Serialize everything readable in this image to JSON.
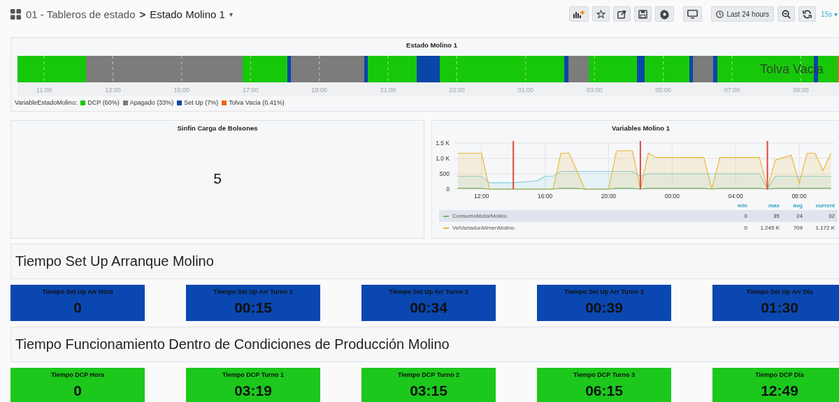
{
  "topbar": {
    "folder": "01 - Tableros de estado",
    "separator": ">",
    "dashboard": "Estado Molino 1",
    "caret": "▾",
    "time_range": "Last 24 hours",
    "refresh_interval": "15s"
  },
  "state_panel": {
    "title": "Estado Molino 1",
    "overlay_label": "Tolva Vacia",
    "time_labels": [
      "11:00",
      "13:00",
      "15:00",
      "17:00",
      "19:00",
      "21:00",
      "23:00",
      "01:00",
      "03:00",
      "05:00",
      "07:00",
      "09:00"
    ],
    "legend_prefix": "VariableEstadoMolino:",
    "legend": [
      {
        "label": "DCP (60%)",
        "color": "#17c80a"
      },
      {
        "label": "Apagado (33%)",
        "color": "#7b7c7b"
      },
      {
        "label": "Set Up (7%)",
        "color": "#0a45a8"
      },
      {
        "label": "Tolva Vacia (0.41%)",
        "color": "#f2620f"
      }
    ]
  },
  "single_stat": {
    "title": "Sinfin Carga de Bolsones",
    "value": "5"
  },
  "graph_panel": {
    "title": "Variables Molino 1",
    "chart_data": {
      "type": "area",
      "categories": [
        null,
        null,
        null,
        "12:00",
        null,
        null,
        null,
        null,
        null,
        null,
        null,
        "16:00",
        null,
        null,
        null,
        null,
        null,
        null,
        null,
        "20:00",
        null,
        null,
        null,
        null,
        null,
        null,
        null,
        "00:00",
        null,
        null,
        null,
        null,
        null,
        null,
        null,
        "04:00",
        null,
        null,
        null,
        null,
        null,
        null,
        null,
        "08:00",
        null,
        null,
        null,
        null
      ],
      "ylim": [
        0,
        1500
      ],
      "yticks": [
        {
          "value": 0,
          "label": "0"
        },
        {
          "value": 500,
          "label": "500"
        },
        {
          "value": 1000,
          "label": "1.0 K"
        },
        {
          "value": 1500,
          "label": "1.5 K"
        }
      ],
      "series": [
        {
          "name": "ConsumoMotorMolino",
          "color": "#7eb26d",
          "values": [
            30,
            30,
            30,
            30,
            0,
            0,
            0,
            0,
            0,
            0,
            0,
            0,
            0,
            30,
            30,
            30,
            0,
            0,
            0,
            0,
            30,
            30,
            30,
            0,
            30,
            30,
            30,
            30,
            30,
            30,
            30,
            30,
            0,
            30,
            30,
            30,
            30,
            30,
            30,
            0,
            30,
            30,
            30,
            30,
            30,
            30,
            30,
            30
          ]
        },
        {
          "name": "VelVariadorAlimenMolino",
          "color": "#eab839",
          "values": [
            1170,
            1170,
            1170,
            1170,
            0,
            0,
            0,
            0,
            0,
            0,
            0,
            0,
            0,
            1170,
            1170,
            600,
            0,
            0,
            0,
            0,
            1250,
            1250,
            1250,
            0,
            1170,
            1030,
            1030,
            1030,
            1030,
            1030,
            1030,
            1030,
            0,
            1030,
            1030,
            1030,
            1030,
            1030,
            1030,
            0,
            950,
            1030,
            1100,
            200,
            1170,
            1170,
            600,
            1170
          ]
        },
        {
          "color": "#82d3e0",
          "values": [
            420,
            420,
            420,
            420,
            210,
            210,
            210,
            210,
            230,
            250,
            270,
            420,
            420,
            580,
            580,
            580,
            580,
            580,
            580,
            580,
            580,
            580,
            580,
            420,
            500,
            500,
            500,
            500,
            500,
            500,
            500,
            500,
            500,
            500,
            500,
            500,
            500,
            500,
            500,
            0,
            420,
            420,
            420,
            420,
            420,
            420,
            420,
            420
          ]
        }
      ],
      "grid": true
    },
    "legend_headers": [
      "min",
      "max",
      "avg",
      "current"
    ],
    "legend_rows": [
      {
        "selected": true,
        "values": [
          "0",
          "35",
          "24",
          "32"
        ]
      },
      {
        "selected": false,
        "values": [
          "0",
          "1.245 K",
          "709",
          "1.172 K"
        ]
      }
    ]
  },
  "sections": [
    {
      "title": "Tiempo Set Up Arranque Molino",
      "color": "#0a47b0",
      "stats": [
        {
          "title": "Tiempo Set Up Arr Hora",
          "value": "0"
        },
        {
          "title": "Tiempo Set Up Arr Turno 1",
          "value": "00:15"
        },
        {
          "title": "Tiempo Set Up Arr Turno 2",
          "value": "00:34"
        },
        {
          "title": "Tiempo Set Up Arr Turno 3",
          "value": "00:39"
        },
        {
          "title": "Tiempo Set Up Arr Día",
          "value": "01:30"
        }
      ]
    },
    {
      "title": "Tiempo Funcionamiento Dentro de Condiciones de Producción Molino",
      "color": "#1cc81c",
      "stats": [
        {
          "title": "Tiempo DCP Hora",
          "value": "0"
        },
        {
          "title": "Tiempo DCP Turno 1",
          "value": "03:19"
        },
        {
          "title": "Tiempo DCP Turno 2",
          "value": "03:15"
        },
        {
          "title": "Tiempo DCP Turno 3",
          "value": "06:15"
        },
        {
          "title": "Tiempo DCP Día",
          "value": "12:49"
        }
      ]
    }
  ]
}
